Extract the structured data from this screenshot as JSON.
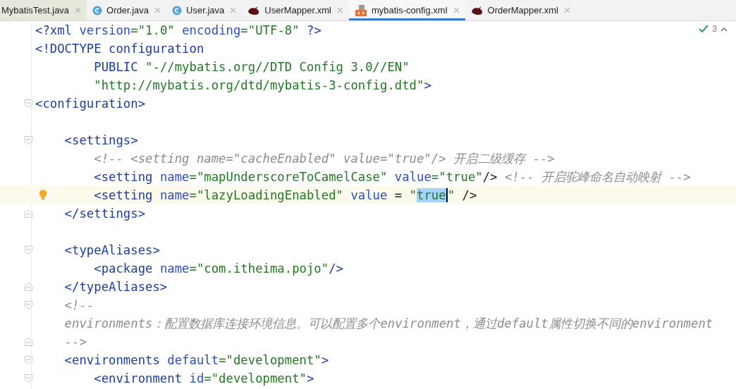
{
  "tabs": [
    {
      "label": "MybatisTest.java",
      "kind": "plain",
      "selected": false
    },
    {
      "label": "Order.java",
      "kind": "class",
      "selected": false
    },
    {
      "label": "User.java",
      "kind": "class",
      "selected": false
    },
    {
      "label": "UserMapper.xml",
      "kind": "mapper",
      "selected": false
    },
    {
      "label": "mybatis-config.xml",
      "kind": "xml",
      "selected": true
    },
    {
      "label": "OrderMapper.xml",
      "kind": "mapper",
      "selected": false
    }
  ],
  "inspections": {
    "count": "3"
  },
  "lines": [
    {
      "current": false,
      "tokens": [
        {
          "kind": "tag",
          "text": "<?xml "
        },
        {
          "kind": "attr",
          "text": "version"
        },
        {
          "kind": "val",
          "text": "=\"1.0\" "
        },
        {
          "kind": "attr",
          "text": "encoding"
        },
        {
          "kind": "val",
          "text": "=\"UTF-8\" "
        },
        {
          "kind": "tag",
          "text": "?>"
        }
      ]
    },
    {
      "current": false,
      "tokens": [
        {
          "kind": "tag",
          "text": "<!DOCTYPE configuration"
        }
      ]
    },
    {
      "current": false,
      "tokens": [
        {
          "kind": "tag",
          "text": "        PUBLIC "
        },
        {
          "kind": "val",
          "text": "\"-//mybatis.org//DTD Config 3.0//EN\""
        }
      ]
    },
    {
      "current": false,
      "tokens": [
        {
          "kind": "val",
          "text": "        \"http://mybatis.org/dtd/mybatis-3-config.dtd\""
        },
        {
          "kind": "tag",
          "text": ">"
        }
      ]
    },
    {
      "current": false,
      "kind": "fold_start",
      "tokens": [
        {
          "kind": "tag",
          "text": "<configuration>"
        }
      ]
    },
    {
      "current": false
    },
    {
      "current": false,
      "kind": "fold_start",
      "tokens": [
        {
          "kind": "tag",
          "text": "    <settings>"
        }
      ]
    },
    {
      "current": false,
      "tokens": [
        {
          "kind": "comment",
          "text": "        <!-- <setting name=\"cacheEnabled\" value=\"true\"/> 开启二级缓存 -->"
        }
      ]
    },
    {
      "current": false,
      "tokens": [
        {
          "kind": "tag",
          "text": "        <setting "
        },
        {
          "kind": "attr",
          "text": "name"
        },
        {
          "kind": "val",
          "text": "=\"mapUnderscoreToCamelCase\" "
        },
        {
          "kind": "attr",
          "text": "value"
        },
        {
          "kind": "val",
          "text": "=\"true\""
        },
        {
          "kind": "plain",
          "text": "/> "
        },
        {
          "kind": "comment",
          "text": "<!-- 开启驼峰命名自动映射 -->"
        }
      ]
    },
    {
      "current": true,
      "bulb": true,
      "tokens": [
        {
          "kind": "tag",
          "text": "        <setting "
        },
        {
          "kind": "attr",
          "text": "name"
        },
        {
          "kind": "val",
          "text": "=\"lazyLoadingEnabled\" "
        },
        {
          "kind": "attr",
          "text": "value"
        },
        {
          "kind": "plain",
          "text": " = "
        },
        {
          "kind": "val",
          "text": "\""
        },
        {
          "kind": "selection",
          "text": "true"
        },
        {
          "kind": "val",
          "text": "\""
        },
        {
          "kind": "plain",
          "text": " />"
        }
      ]
    },
    {
      "current": false,
      "kind": "fold_end",
      "tokens": [
        {
          "kind": "tag",
          "text": "    </settings>"
        }
      ]
    },
    {
      "current": false
    },
    {
      "current": false,
      "kind": "fold_start",
      "tokens": [
        {
          "kind": "tag",
          "text": "    <typeAliases>"
        }
      ]
    },
    {
      "current": false,
      "tokens": [
        {
          "kind": "tag",
          "text": "        <package "
        },
        {
          "kind": "attr",
          "text": "name"
        },
        {
          "kind": "val",
          "text": "=\"com.itheima.pojo\""
        },
        {
          "kind": "tag",
          "text": "/>"
        }
      ]
    },
    {
      "current": false,
      "kind": "fold_end",
      "tokens": [
        {
          "kind": "tag",
          "text": "    </typeAliases>"
        }
      ]
    },
    {
      "current": false,
      "kind": "fold_start",
      "tokens": [
        {
          "kind": "comment",
          "text": "    <!--"
        }
      ]
    },
    {
      "current": false,
      "tokens": [
        {
          "kind": "comment",
          "text": "    environments：配置数据库连接环境信息。可以配置多个environment，通过default属性切换不同的environment"
        }
      ]
    },
    {
      "current": false,
      "kind": "fold_end",
      "tokens": [
        {
          "kind": "comment",
          "text": "    -->"
        }
      ]
    },
    {
      "current": false,
      "kind": "fold_start",
      "tokens": [
        {
          "kind": "tag",
          "text": "    <environments "
        },
        {
          "kind": "attr",
          "text": "default"
        },
        {
          "kind": "val",
          "text": "=\"development\""
        },
        {
          "kind": "tag",
          "text": ">"
        }
      ]
    },
    {
      "current": false,
      "kind": "fold_start",
      "tokens": [
        {
          "kind": "tag",
          "text": "        <environment "
        },
        {
          "kind": "attr",
          "text": "id"
        },
        {
          "kind": "val",
          "text": "=\"development\""
        },
        {
          "kind": "tag",
          "text": ">"
        }
      ]
    }
  ]
}
